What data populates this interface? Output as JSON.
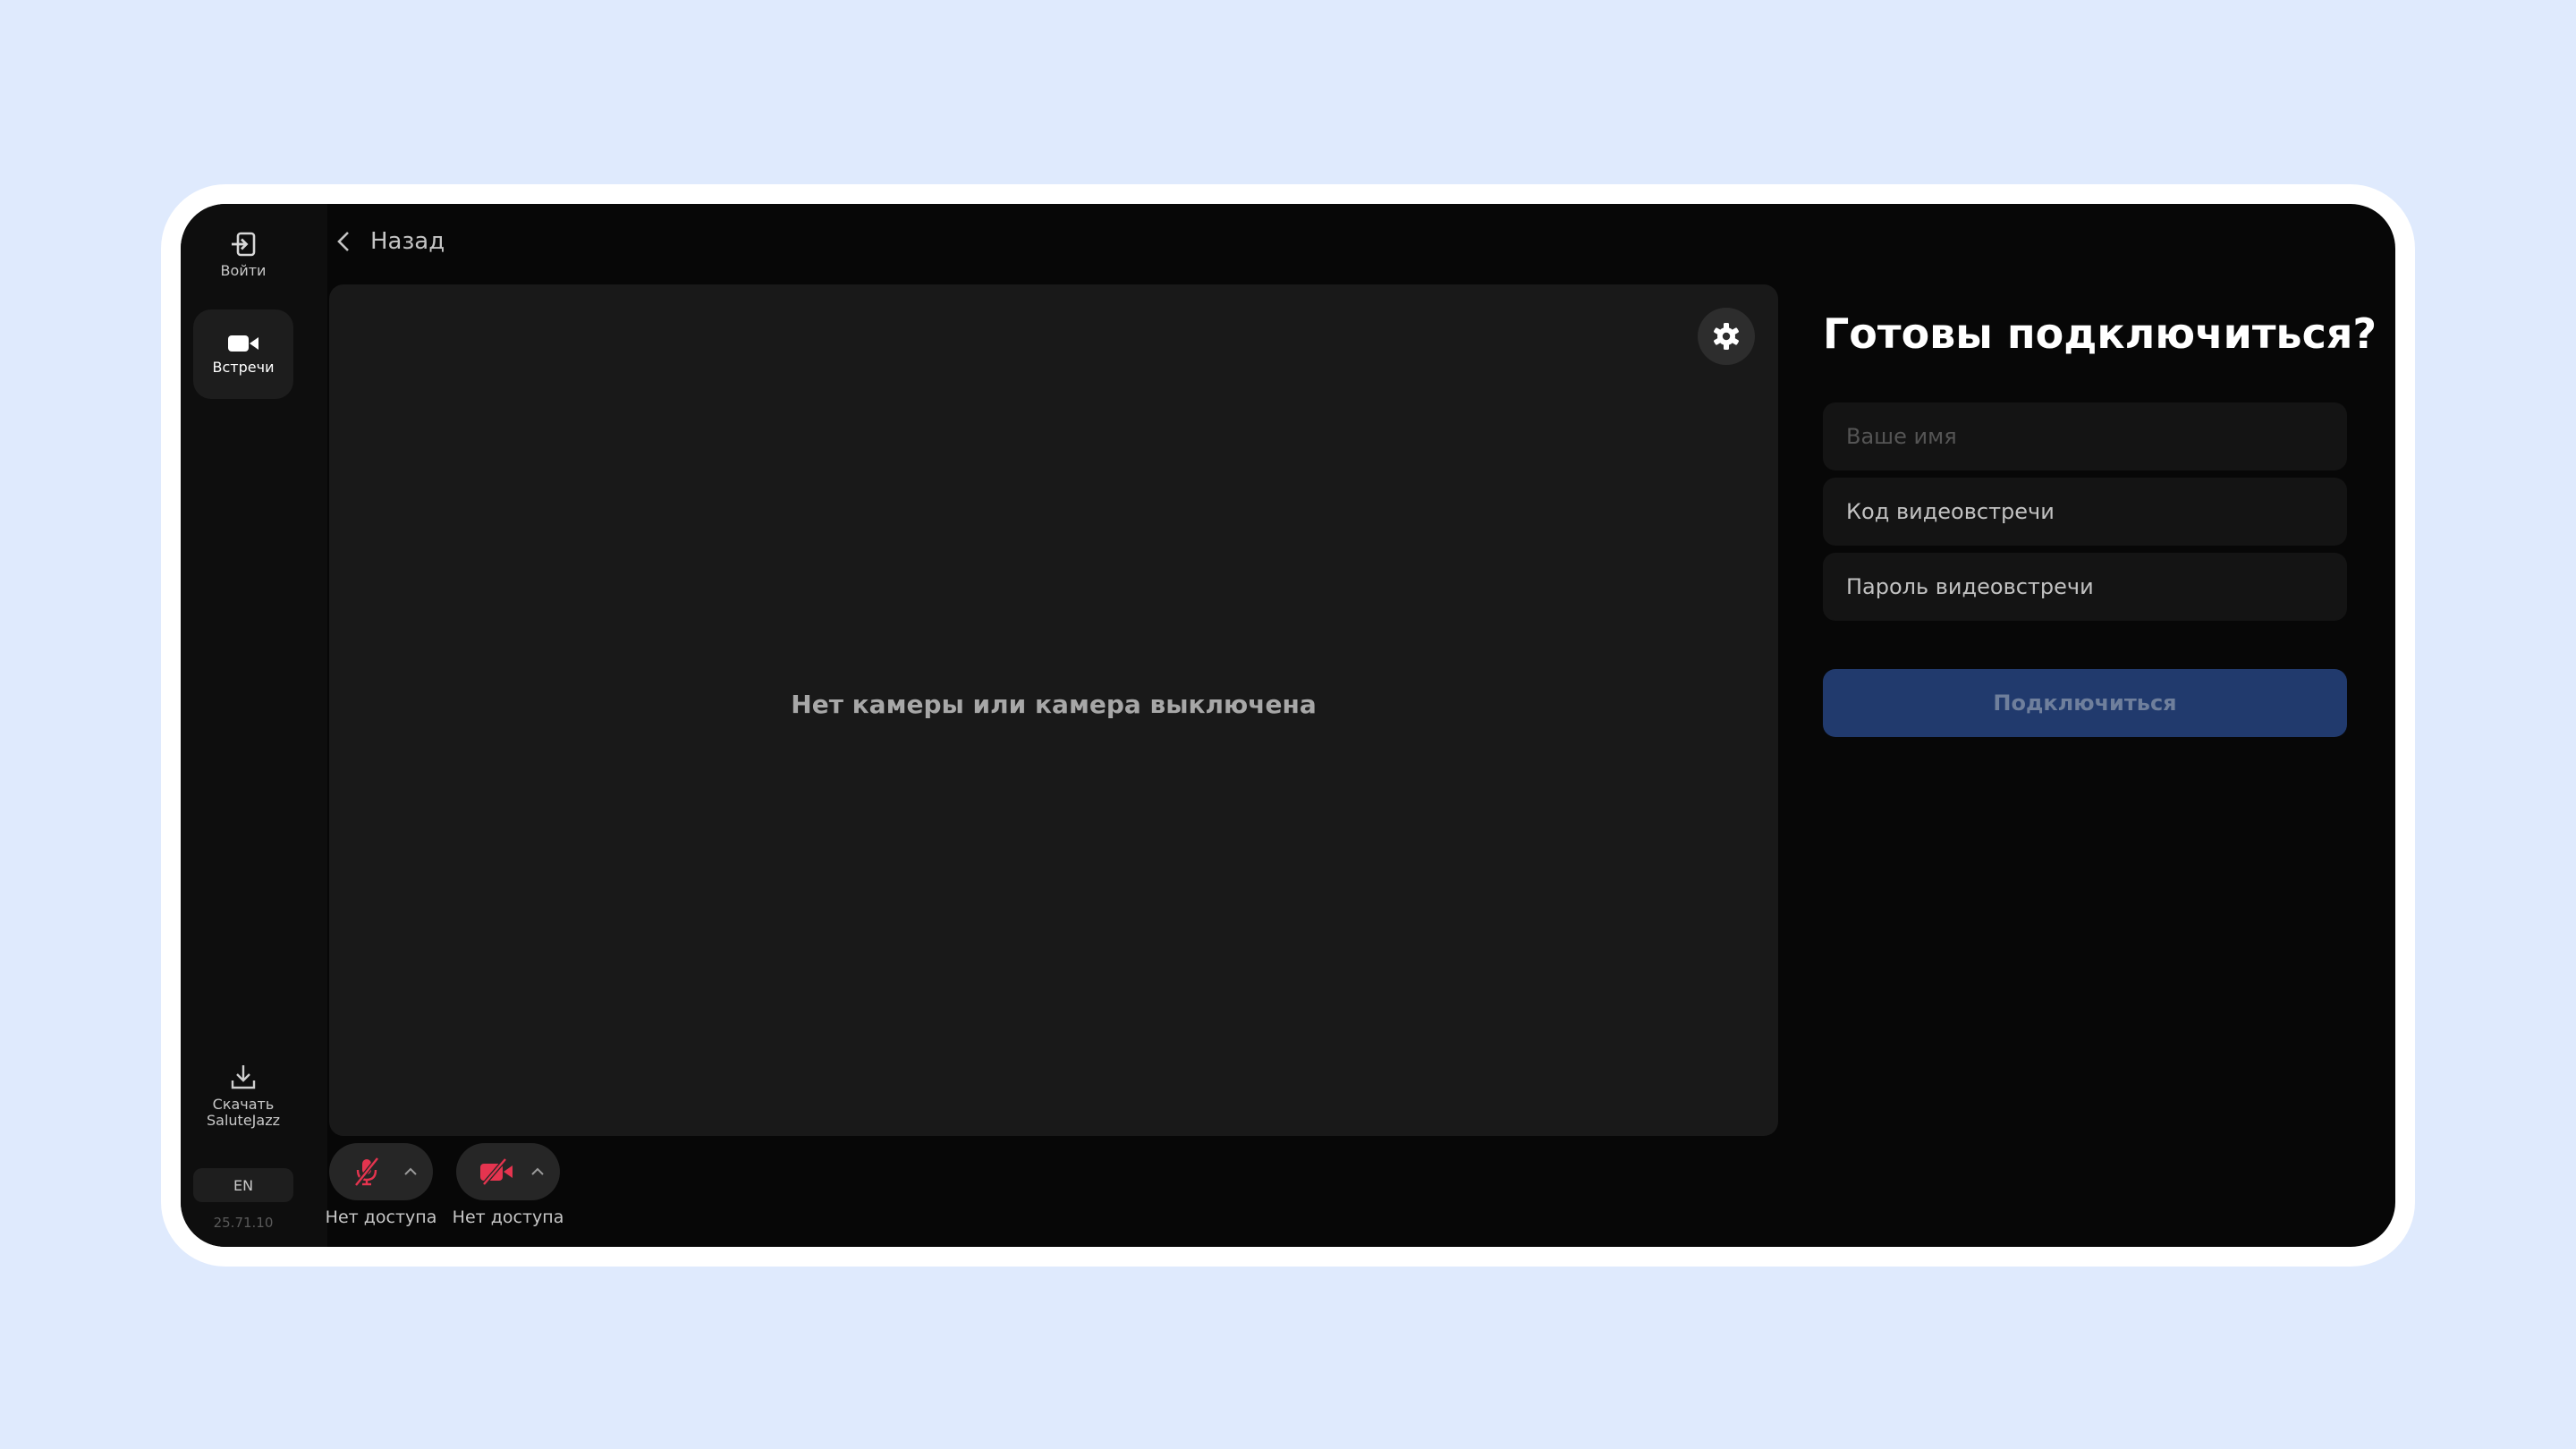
{
  "sidebar": {
    "login_label": "Войти",
    "meetings_label": "Встречи",
    "download_label_line1": "Скачать",
    "download_label_line2": "SaluteJazz",
    "language": "EN",
    "version": "25.71.10"
  },
  "back_label": "Назад",
  "preview": {
    "message": "Нет камеры или камера выключена"
  },
  "controls": {
    "mic_status": "Нет доступа",
    "camera_status": "Нет доступа"
  },
  "join_form": {
    "heading": "Готовы подключиться?",
    "name_placeholder": "Ваше имя",
    "code_placeholder": "Код видеовстречи",
    "password_placeholder": "Пароль видеовстречи",
    "connect_label": "Подключиться"
  },
  "colors": {
    "page_background": "#dfeafd",
    "app_background": "#070707",
    "accent_button": "#213a6d",
    "muted_red": "#e5344f"
  }
}
